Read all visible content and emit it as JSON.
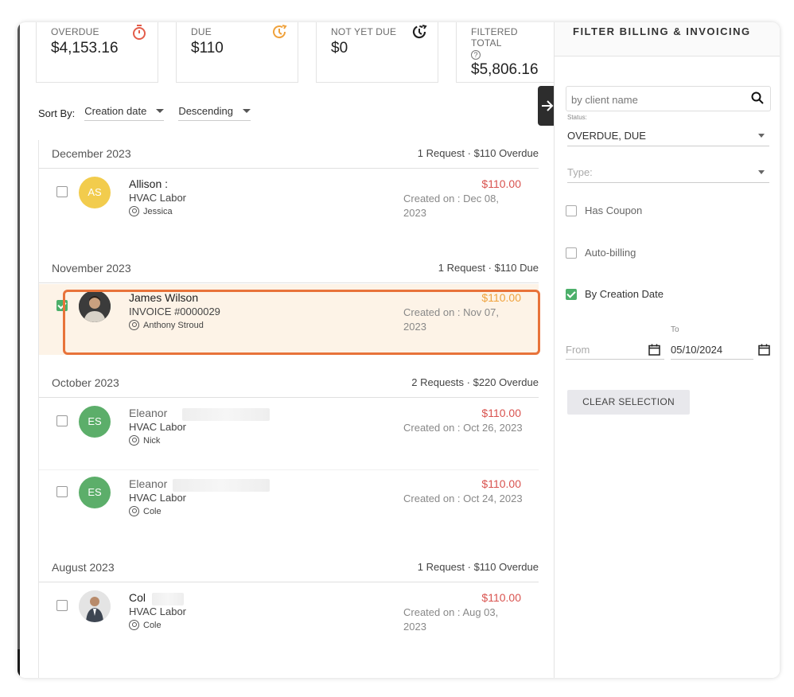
{
  "cards": [
    {
      "label": "OVERDUE",
      "value": "$4,153.16",
      "icon": "stopwatch-icon",
      "color": "#e35d4a"
    },
    {
      "label": "DUE",
      "value": "$110",
      "icon": "clock-alert-icon",
      "color": "#f0a23c"
    },
    {
      "label": "NOT YET DUE",
      "value": "$0",
      "icon": "clock-pending-icon",
      "color": "#222222"
    },
    {
      "label": "FILTERED TOTAL",
      "value": "$5,806.16",
      "icon": "help-icon"
    }
  ],
  "sort": {
    "label": "Sort By:",
    "field": "Creation date",
    "order": "Descending"
  },
  "groups": [
    {
      "month": "December 2023",
      "summary": "1 Request · $110 Overdue"
    },
    {
      "month": "November 2023",
      "summary": "1 Request · $110 Due"
    },
    {
      "month": "October 2023",
      "summary": "2 Requests · $220 Overdue"
    },
    {
      "month": "August 2023",
      "summary": "1 Request · $110 Overdue"
    }
  ],
  "items": [
    {
      "initials": "AS",
      "name": "Allison :",
      "sub": "HVAC Labor",
      "agent": "Jessica",
      "amount": "$110.00",
      "created": "Created on : Dec 08, 2023",
      "checked": false
    },
    {
      "initials": "",
      "name": "James Wilson",
      "sub": "INVOICE #0000029",
      "agent": "Anthony Stroud",
      "amount": "$110.00",
      "created": "Created on : Nov 07, 2023",
      "checked": true
    },
    {
      "initials": "ES",
      "name": "Eleanor",
      "sub": "HVAC Labor",
      "agent": "Nick",
      "amount": "$110.00",
      "created": "Created on : Oct 26, 2023",
      "checked": false
    },
    {
      "initials": "ES",
      "name": "Eleanor",
      "sub": "HVAC Labor",
      "agent": "Cole",
      "amount": "$110.00",
      "created": "Created on : Oct 24, 2023",
      "checked": false
    },
    {
      "initials": "",
      "name": "Col",
      "sub": "HVAC Labor",
      "agent": "Cole",
      "amount": "$110.00",
      "created": "Created on : Aug 03, 2023",
      "checked": false
    }
  ],
  "filter": {
    "title": "FILTER BILLING & INVOICING",
    "search_placeholder": "by client name",
    "status_label": "Status:",
    "status_value": "OVERDUE, DUE",
    "type_placeholder": "Type:",
    "has_coupon": "Has Coupon",
    "auto_billing": "Auto-billing",
    "by_creation_date": "By Creation Date",
    "from_placeholder": "From",
    "to_label": "To",
    "to_value": "05/10/2024",
    "clear_button": "CLEAR SELECTION"
  },
  "colors": {
    "accent_highlight": "#e8733a",
    "overdue": "#d9534f",
    "due": "#f0a23c",
    "checked": "#4caf6a"
  }
}
